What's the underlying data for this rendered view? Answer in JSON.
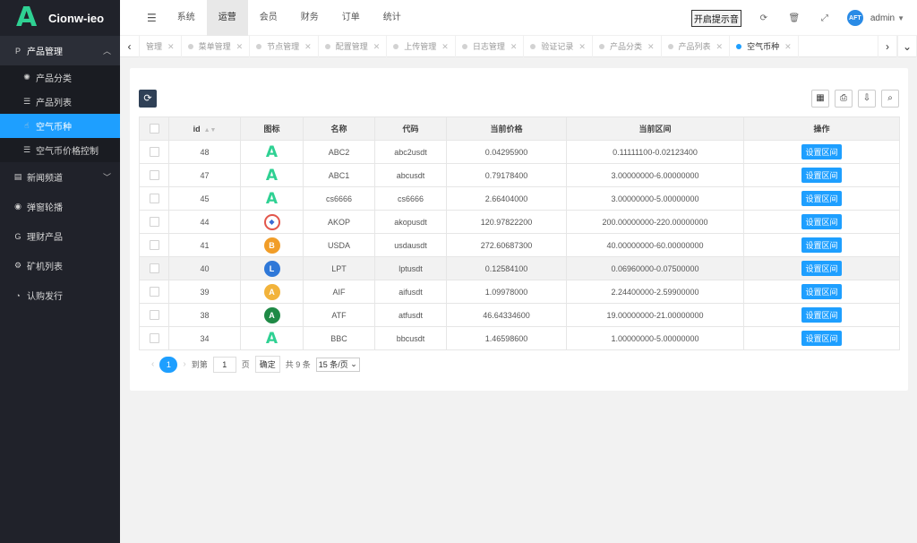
{
  "app": {
    "logo_letter": "A",
    "name": "Cionw-ieo"
  },
  "sidebar": {
    "group": {
      "label": "产品管理",
      "icon": "P"
    },
    "sub_items": [
      {
        "label": "产品分类",
        "icon": "✺"
      },
      {
        "label": "产品列表",
        "icon": "☰"
      },
      {
        "label": "空气币种",
        "icon": "☝"
      },
      {
        "label": "空气币价格控制",
        "icon": "☰"
      }
    ],
    "items": [
      {
        "label": "新闻频道",
        "icon": "▤"
      },
      {
        "label": "弹窗轮播",
        "icon": "◉"
      },
      {
        "label": "理财产品",
        "icon": "G"
      },
      {
        "label": "矿机列表",
        "icon": "⚙"
      },
      {
        "label": "认购发行",
        "icon": "◔"
      }
    ]
  },
  "topbar": {
    "toggle": "☰",
    "menus": [
      "系统",
      "运营",
      "会员",
      "财务",
      "订单",
      "统计"
    ],
    "sound_button": "开启提示音",
    "avatar": "AFT",
    "user": "admin"
  },
  "tabs": [
    "管理",
    "菜单管理",
    "节点管理",
    "配置管理",
    "上传管理",
    "日志管理",
    "验证记录",
    "产品分类",
    "产品列表",
    "空气币种"
  ],
  "table": {
    "columns": [
      "id",
      "图标",
      "名称",
      "代码",
      "当前价格",
      "当前区间",
      "操作"
    ],
    "action_label": "设置区间",
    "rows": [
      {
        "id": "48",
        "icon": "A",
        "icon_type": "a",
        "name": "ABC2",
        "code": "abc2usdt",
        "price": "0.04295900",
        "range": "0.11111100-0.02123400"
      },
      {
        "id": "47",
        "icon": "A",
        "icon_type": "a",
        "name": "ABC1",
        "code": "abcusdt",
        "price": "0.79178400",
        "range": "3.00000000-6.00000000"
      },
      {
        "id": "45",
        "icon": "A",
        "icon_type": "a",
        "name": "cs6666",
        "code": "cs6666",
        "price": "2.66404000",
        "range": "3.00000000-5.00000000"
      },
      {
        "id": "44",
        "icon": "◆",
        "icon_type": "akop",
        "name": "AKOP",
        "code": "akopusdt",
        "price": "120.97822200",
        "range": "200.00000000-220.00000000"
      },
      {
        "id": "41",
        "icon": "B",
        "icon_type": "usda",
        "name": "USDA",
        "code": "usdausdt",
        "price": "272.60687300",
        "range": "40.00000000-60.00000000"
      },
      {
        "id": "40",
        "icon": "L",
        "icon_type": "lpt",
        "name": "LPT",
        "code": "lptusdt",
        "price": "0.12584100",
        "range": "0.06960000-0.07500000"
      },
      {
        "id": "39",
        "icon": "A",
        "icon_type": "aif",
        "name": "AIF",
        "code": "aifusdt",
        "price": "1.09978000",
        "range": "2.24400000-2.59900000"
      },
      {
        "id": "38",
        "icon": "A",
        "icon_type": "atf",
        "name": "ATF",
        "code": "atfusdt",
        "price": "46.64334600",
        "range": "19.00000000-21.00000000"
      },
      {
        "id": "34",
        "icon": "A",
        "icon_type": "a",
        "name": "BBC",
        "code": "bbcusdt",
        "price": "1.46598600",
        "range": "1.00000000-5.00000000"
      }
    ]
  },
  "pager": {
    "current": "1",
    "goto_label": "到第",
    "goto_value": "1",
    "page_unit": "页",
    "confirm": "确定",
    "total": "共 9 条",
    "page_size": "15 条/页"
  },
  "colors": {
    "accent": "#1e9fff",
    "sidebar": "#20222a",
    "logo": "#2fd193"
  }
}
